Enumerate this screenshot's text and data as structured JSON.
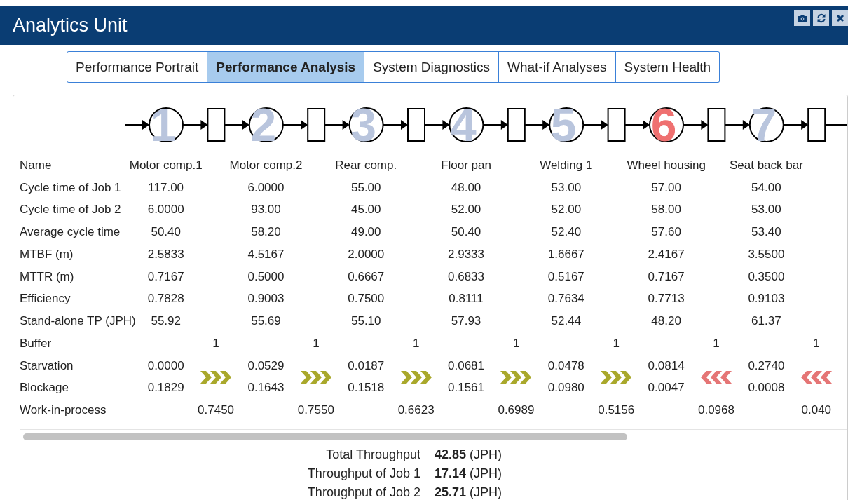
{
  "window": {
    "title": "Analytics Unit"
  },
  "tabs": [
    {
      "label": "Performance Portrait",
      "selected": false
    },
    {
      "label": "Performance Analysis",
      "selected": true
    },
    {
      "label": "System Diagnostics",
      "selected": false
    },
    {
      "label": "What-if Analyses",
      "selected": false
    },
    {
      "label": "System Health",
      "selected": false
    }
  ],
  "stations": [
    {
      "number": "1",
      "bottleneck": false
    },
    {
      "number": "2",
      "bottleneck": false
    },
    {
      "number": "3",
      "bottleneck": false
    },
    {
      "number": "4",
      "bottleneck": false
    },
    {
      "number": "5",
      "bottleneck": false
    },
    {
      "number": "6",
      "bottleneck": true
    },
    {
      "number": "7",
      "bottleneck": false
    }
  ],
  "table": {
    "rows": [
      {
        "label": "Name",
        "kind": "station",
        "cells": [
          "Motor comp.1",
          "Motor comp.2",
          "Rear comp.",
          "Floor pan",
          "Welding 1",
          "Wheel housing",
          "Seat back bar"
        ]
      },
      {
        "label": "Cycle time of Job 1",
        "kind": "station",
        "cells": [
          "117.00",
          "6.0000",
          "55.00",
          "48.00",
          "53.00",
          "57.00",
          "54.00"
        ]
      },
      {
        "label": "Cycle time of Job 2",
        "kind": "station",
        "cells": [
          "6.0000",
          "93.00",
          "45.00",
          "52.00",
          "52.00",
          "58.00",
          "53.00"
        ]
      },
      {
        "label": "Average cycle time",
        "kind": "station",
        "cells": [
          "50.40",
          "58.20",
          "49.00",
          "50.40",
          "52.40",
          "57.60",
          "53.40"
        ]
      },
      {
        "label": "MTBF (m)",
        "kind": "station",
        "cells": [
          "2.5833",
          "4.5167",
          "2.0000",
          "2.9333",
          "1.6667",
          "2.4167",
          "3.5500"
        ]
      },
      {
        "label": "MTTR (m)",
        "kind": "station",
        "cells": [
          "0.7167",
          "0.5000",
          "0.6667",
          "0.6833",
          "0.5167",
          "0.7167",
          "0.3500"
        ]
      },
      {
        "label": "Efficiency",
        "kind": "station",
        "cells": [
          "0.7828",
          "0.9003",
          "0.7500",
          "0.8111",
          "0.7634",
          "0.7713",
          "0.9103"
        ]
      },
      {
        "label": "Stand-alone TP (JPH)",
        "kind": "station",
        "cells": [
          "55.92",
          "55.69",
          "55.10",
          "57.93",
          "52.44",
          "48.20",
          "61.37"
        ]
      },
      {
        "label": "Buffer",
        "kind": "buffer",
        "cells": [
          "1",
          "1",
          "1",
          "1",
          "1",
          "1",
          "1"
        ]
      },
      {
        "label": "Starvation",
        "kind": "starvation",
        "cells": [
          "0.0000",
          "0.0529",
          "0.0187",
          "0.0681",
          "0.0478",
          "0.0814",
          "0.2740"
        ]
      },
      {
        "label": "Blockage",
        "kind": "station",
        "cells": [
          "0.1829",
          "0.1643",
          "0.1518",
          "0.1561",
          "0.0980",
          "0.0047",
          "0.0008"
        ]
      },
      {
        "label": "Work-in-process",
        "kind": "buffer",
        "cells": [
          "0.7450",
          "0.7550",
          "0.6623",
          "0.6989",
          "0.5156",
          "0.0968",
          "0.040"
        ]
      }
    ],
    "flow_arrows": [
      {
        "backward": false
      },
      {
        "backward": false
      },
      {
        "backward": false
      },
      {
        "backward": false
      },
      {
        "backward": false
      },
      {
        "backward": true
      },
      {
        "backward": true
      }
    ]
  },
  "totals": [
    {
      "label": "Total Throughput",
      "value": "42.85",
      "unit": "(JPH)"
    },
    {
      "label": "Throughput of Job 1",
      "value": "17.14",
      "unit": "(JPH)"
    },
    {
      "label": "Throughput of Job 2",
      "value": "25.71",
      "unit": "(JPH)"
    }
  ]
}
